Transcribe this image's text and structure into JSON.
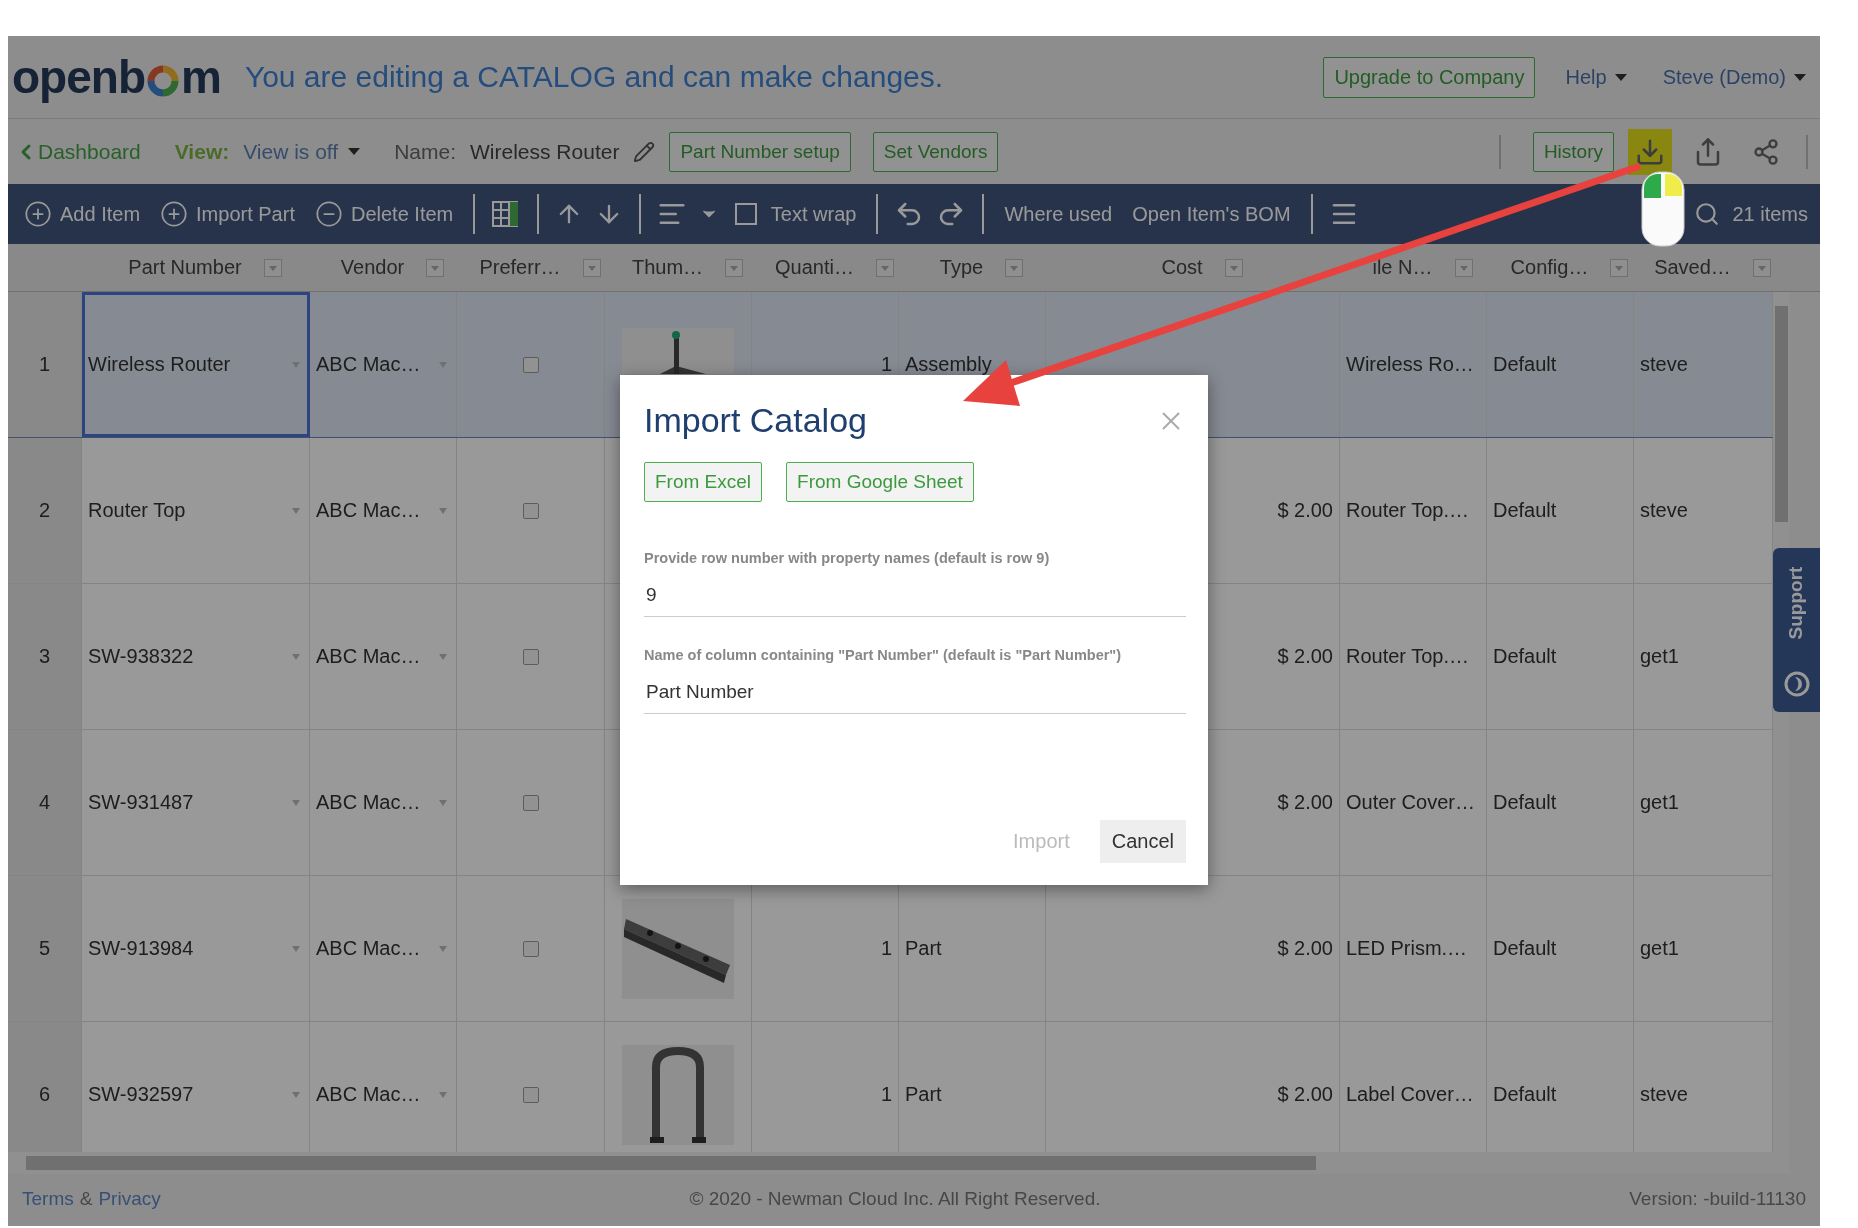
{
  "header": {
    "logo": {
      "before": "openb",
      "after": "m"
    },
    "banner": "You are editing a CATALOG and can make changes.",
    "upgrade_button": "Upgrade to Company",
    "menus": [
      {
        "label": "Help"
      },
      {
        "label": "Steve (Demo)"
      }
    ]
  },
  "subheader": {
    "back_link": "Dashboard",
    "view_label": "View:",
    "view_value": "View is off",
    "name_label": "Name:",
    "name_value": "Wireless Router",
    "buttons": [
      "Part Number setup",
      "Set Vendors"
    ],
    "history_button": "History",
    "icon_buttons": [
      {
        "kind": "download",
        "highlighted": true
      },
      {
        "kind": "export",
        "highlighted": false
      },
      {
        "kind": "share",
        "highlighted": false
      }
    ]
  },
  "toolbar": {
    "add_item": "Add Item",
    "import_part": "Import Part",
    "delete_item": "Delete Item",
    "text_wrap": {
      "label": "Text wrap",
      "checked": false
    },
    "where_used": "Where used",
    "open_bom": "Open Item's BOM",
    "item_count": "21 items"
  },
  "table": {
    "columns": [
      "Part Number",
      "Vendor",
      "Preferr…",
      "Thum…",
      "Quanti…",
      "Type",
      "Cost",
      "ile N…",
      "Config…",
      "Saved…"
    ],
    "rows": [
      {
        "number": "1",
        "part_number": "Wireless Router",
        "vendor": "ABC Mac…",
        "preferred": false,
        "quantity": "1",
        "type": "Assembly",
        "file_name": "Wireless Ro…",
        "configuration": "Default",
        "saved_by": "steve",
        "selected": true,
        "focused": true
      },
      {
        "number": "2",
        "part_number": "Router Top",
        "vendor": "ABC Mac…",
        "preferred": false,
        "cost": "$ 2.00",
        "file_name": "Router Top.…",
        "configuration": "Default",
        "saved_by": "steve",
        "selected": false,
        "focused": false
      },
      {
        "number": "3",
        "part_number": "SW-938322",
        "vendor": "ABC Mac…",
        "preferred": false,
        "cost": "$ 2.00",
        "file_name": "Router Top.…",
        "configuration": "Default",
        "saved_by": "get1",
        "selected": false,
        "focused": false
      },
      {
        "number": "4",
        "part_number": "SW-931487",
        "vendor": "ABC Mac…",
        "preferred": false,
        "cost": "$ 2.00",
        "file_name": "Outer Cover…",
        "configuration": "Default",
        "saved_by": "get1",
        "selected": false,
        "focused": false
      },
      {
        "number": "5",
        "part_number": "SW-913984",
        "vendor": "ABC Mac…",
        "preferred": false,
        "quantity": "1",
        "type": "Part",
        "cost": "$ 2.00",
        "file_name": "LED Prism.…",
        "configuration": "Default",
        "saved_by": "get1",
        "selected": false,
        "focused": false
      },
      {
        "number": "6",
        "part_number": "SW-932597",
        "vendor": "ABC Mac…",
        "preferred": false,
        "quantity": "1",
        "type": "Part",
        "cost": "$ 2.00",
        "file_name": "Label Cover…",
        "configuration": "Default",
        "saved_by": "steve",
        "selected": false,
        "focused": false
      }
    ]
  },
  "support_tab": "Support",
  "dialog": {
    "title": "Import Catalog",
    "sources": [
      "From Excel",
      "From Google Sheet"
    ],
    "fields": [
      {
        "label": "Provide row number with property names (default is row 9)",
        "value": "9"
      },
      {
        "label": "Name of column containing \"Part Number\" (default is \"Part Number\")",
        "value": "Part Number"
      }
    ],
    "import_button": {
      "label": "Import",
      "disabled": true
    },
    "cancel_button": "Cancel"
  },
  "footer": {
    "terms": "Terms",
    "ampersand": "&",
    "privacy": "Privacy",
    "copyright": "© 2020 - Newman Cloud Inc. All Right Reserved.",
    "version": "Version: -build-11130"
  }
}
